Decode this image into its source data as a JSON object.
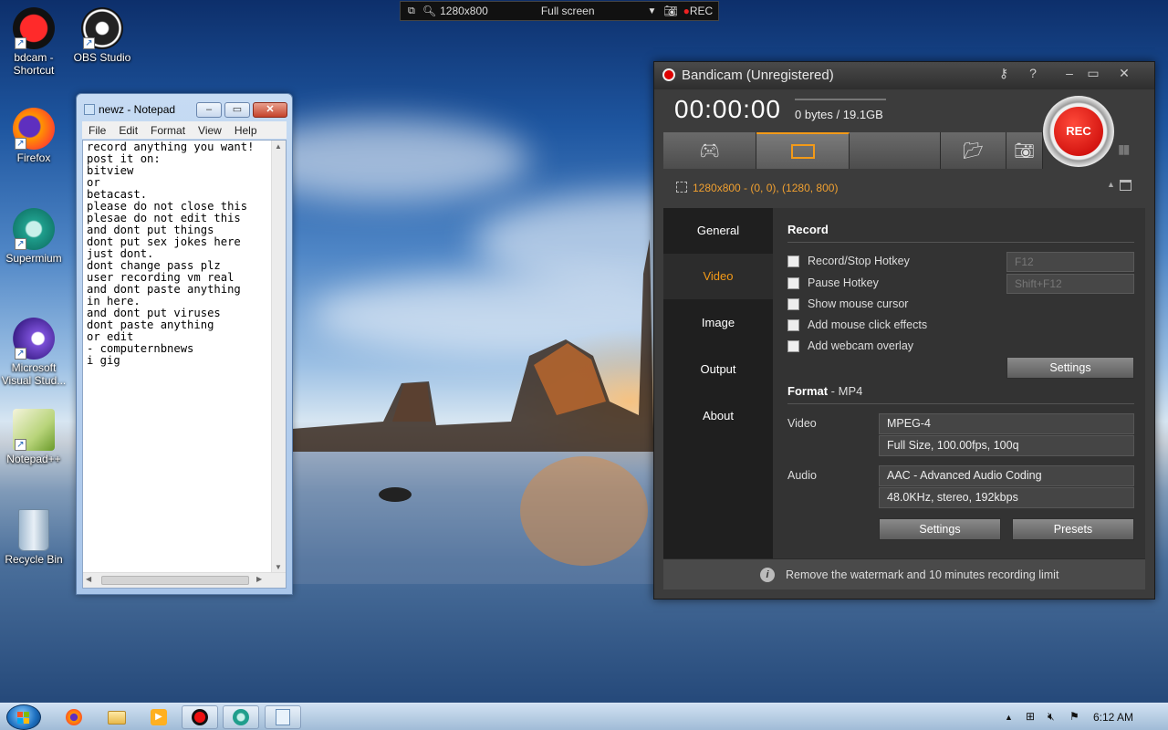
{
  "desktop": {
    "icons": [
      {
        "label": "bdcam - Shortcut",
        "icon": "bandicam-icon"
      },
      {
        "label": "OBS Studio",
        "icon": "obs-icon"
      },
      {
        "label": "Firefox",
        "icon": "firefox-icon"
      },
      {
        "label": "Supermium",
        "icon": "supermium-icon"
      },
      {
        "label": "Microsoft Visual Stud...",
        "icon": "visual-studio-icon"
      },
      {
        "label": "Notepad++",
        "icon": "notepadpp-icon"
      },
      {
        "label": "Recycle Bin",
        "icon": "recycle-bin-icon"
      }
    ]
  },
  "rec_bar": {
    "resolution": "1280x800",
    "mode": "Full screen",
    "rec_label": "REC"
  },
  "notepad": {
    "title": "newz - Notepad",
    "menu": [
      "File",
      "Edit",
      "Format",
      "View",
      "Help"
    ],
    "text": "record anything you want!\npost it on:\nbitview\nor\nbetacast.\nplease do not close this\nplesae do not edit this\nand dont put things\ndont put sex jokes here\njust dont.\ndont change pass plz\nuser recording vm real\nand dont paste anything\nin here.\nand dont put viruses\ndont paste anything\nor edit\n- computernbnews\ni gig"
  },
  "bandicam": {
    "title": "Bandicam (Unregistered)",
    "timer": "00:00:00",
    "size": "0 bytes / 19.1GB",
    "rec_button": "REC",
    "region": "1280x800 - (0, 0), (1280, 800)",
    "sidebar": [
      "General",
      "Video",
      "Image",
      "Output",
      "About"
    ],
    "active_sidebar": "Video",
    "record": {
      "heading": "Record",
      "options": [
        {
          "label": "Record/Stop Hotkey",
          "checked": false
        },
        {
          "label": "Pause Hotkey",
          "checked": false
        },
        {
          "label": "Show mouse cursor",
          "checked": false
        },
        {
          "label": "Add mouse click effects",
          "checked": false
        },
        {
          "label": "Add webcam overlay",
          "checked": false
        }
      ],
      "hotkey_record": "F12",
      "hotkey_pause": "Shift+F12",
      "settings_button": "Settings"
    },
    "format": {
      "heading": "Format",
      "container": " - MP4",
      "video_label": "Video",
      "video_codec": "MPEG-4",
      "video_details": "Full Size, 100.00fps, 100q",
      "audio_label": "Audio",
      "audio_codec": "AAC - Advanced Audio Coding",
      "audio_details": "48.0KHz, stereo, 192kbps",
      "settings_button": "Settings",
      "presets_button": "Presets"
    },
    "footer": "Remove the watermark and 10 minutes recording limit",
    "accent_color": "#f39a18"
  },
  "taskbar": {
    "clock": "6:12 AM",
    "apps": [
      "firefox-icon",
      "file-explorer-icon",
      "media-player-icon",
      "bandicam-icon",
      "supermium-icon",
      "notepad-icon"
    ]
  }
}
